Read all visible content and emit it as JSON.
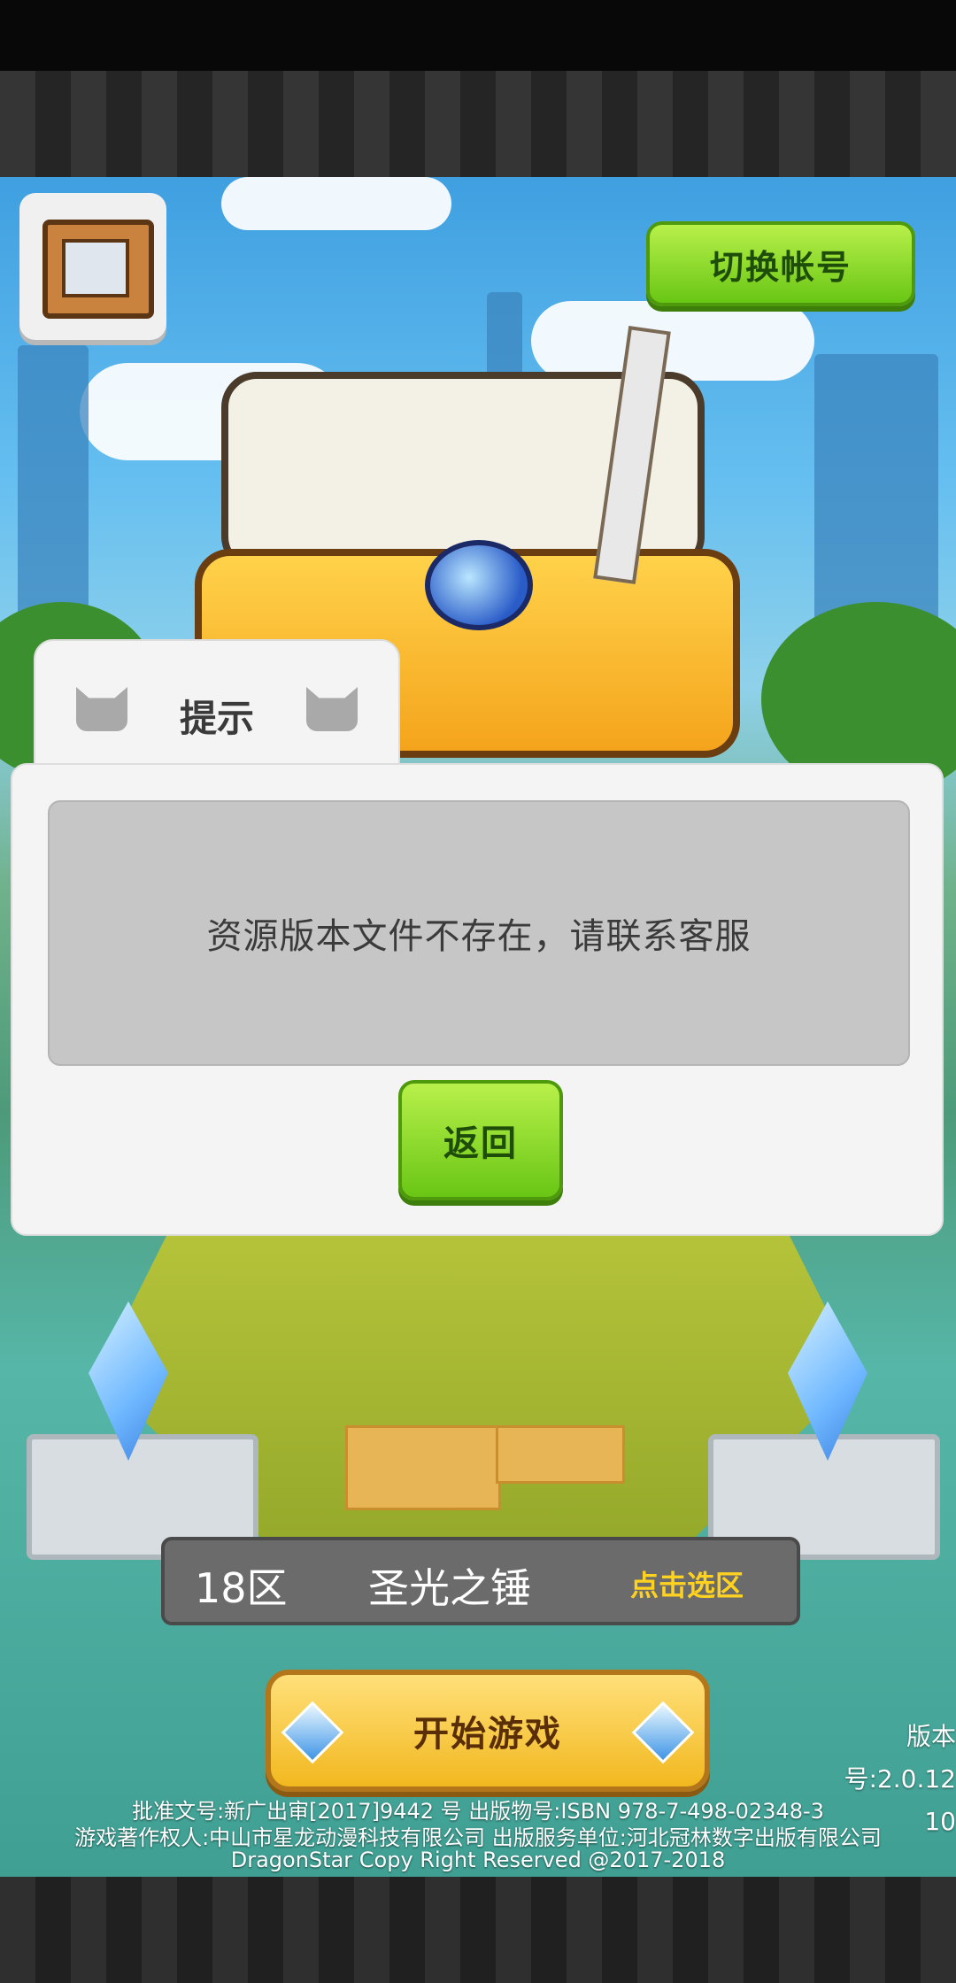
{
  "header": {
    "switch_account_label": "切换帐号"
  },
  "dialog": {
    "title": "提示",
    "message": "资源版本文件不存在，请联系客服",
    "back_label": "返回"
  },
  "server": {
    "zone": "18区",
    "name": "圣光之锤",
    "select_label": "点击选区"
  },
  "start_label": "开始游戏",
  "version": {
    "line1": "版本号:2.0.12",
    "line2": "10"
  },
  "legal": {
    "line1": "批准文号:新广出审[2017]9442 号   出版物号:ISBN 978-7-498-02348-3",
    "line2": "游戏著作权人:中山市星龙动漫科技有限公司 出版服务单位:河北冠林数字出版有限公司",
    "line3": "DragonStar Copy Right Reserved @2017-2018"
  },
  "icons": {
    "menu": "house-icon",
    "dialog_left": "cat-icon",
    "dialog_right": "cat-icon",
    "start_left": "gem-icon",
    "start_right": "gem-icon"
  },
  "colors": {
    "green_button": "#69c614",
    "gold_button": "#f2b81f",
    "select_text": "#ffd21f"
  }
}
